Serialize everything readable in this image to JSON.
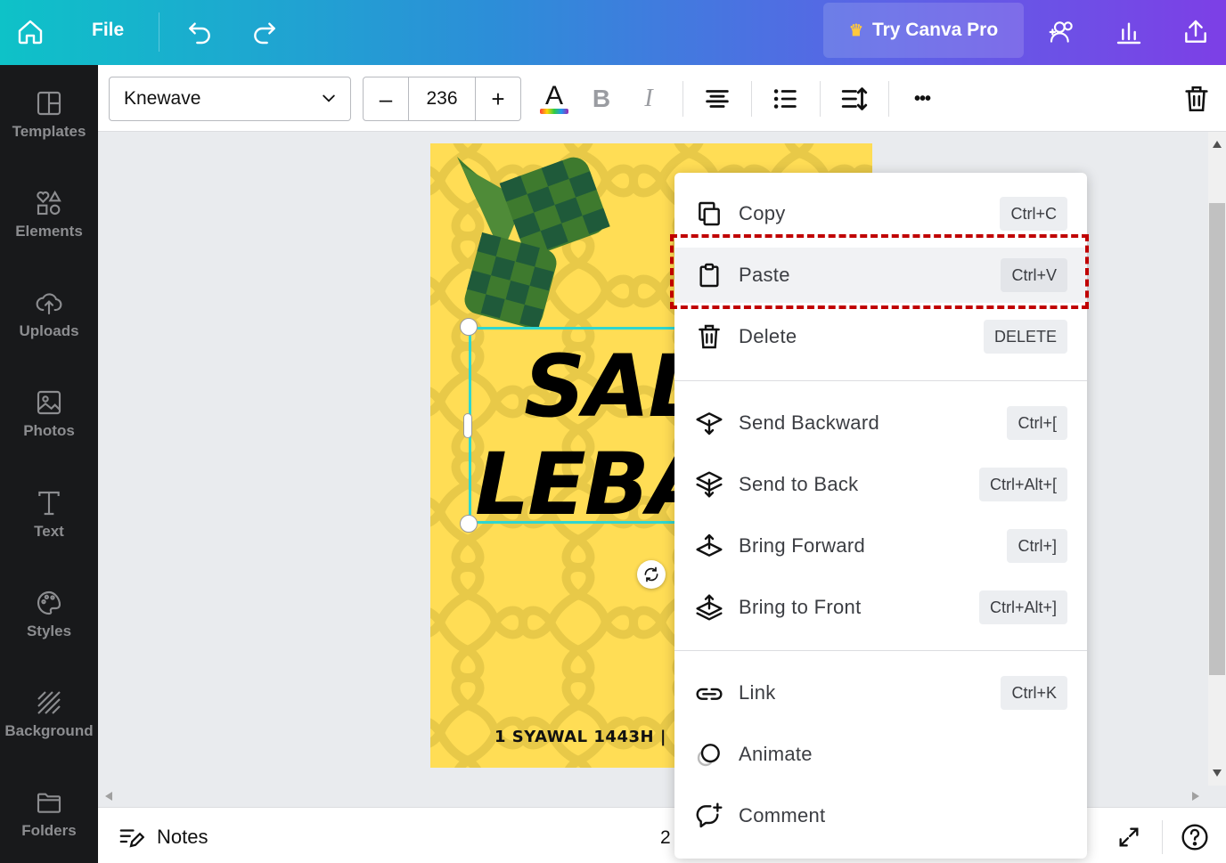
{
  "topbar": {
    "file_label": "File",
    "try_pro_label": "Try Canva Pro",
    "icons": [
      "home-icon",
      "undo-icon",
      "redo-icon",
      "share-people-icon",
      "insights-icon",
      "upload-share-icon"
    ]
  },
  "sidebar": {
    "items": [
      {
        "label": "Templates",
        "icon": "templates-icon"
      },
      {
        "label": "Elements",
        "icon": "elements-icon"
      },
      {
        "label": "Uploads",
        "icon": "uploads-icon"
      },
      {
        "label": "Photos",
        "icon": "photos-icon"
      },
      {
        "label": "Text",
        "icon": "text-icon"
      },
      {
        "label": "Styles",
        "icon": "styles-icon"
      },
      {
        "label": "Background",
        "icon": "background-icon"
      },
      {
        "label": "Folders",
        "icon": "folders-icon"
      }
    ]
  },
  "toolbar": {
    "font_name": "Knewave",
    "font_size": "236",
    "minus_label": "–",
    "plus_label": "+",
    "text_color_letter": "A",
    "bold_letter": "B",
    "italic_letter": "I",
    "more_label": "•••"
  },
  "design": {
    "title_line1": "SALA",
    "title_line2": "LEBAR",
    "footer_text": "1 SYAWAL 1443H  |",
    "background_color": "#ffdd55"
  },
  "context_menu": {
    "items": [
      {
        "label": "Copy",
        "shortcut": "Ctrl+C",
        "icon": "copy-icon"
      },
      {
        "label": "Paste",
        "shortcut": "Ctrl+V",
        "icon": "paste-icon"
      },
      {
        "label": "Delete",
        "shortcut": "DELETE",
        "icon": "trash-icon"
      },
      {
        "label": "Send Backward",
        "shortcut": "Ctrl+[",
        "icon": "send-backward-icon"
      },
      {
        "label": "Send to Back",
        "shortcut": "Ctrl+Alt+[",
        "icon": "send-to-back-icon"
      },
      {
        "label": "Bring Forward",
        "shortcut": "Ctrl+]",
        "icon": "bring-forward-icon"
      },
      {
        "label": "Bring to Front",
        "shortcut": "Ctrl+Alt+]",
        "icon": "bring-to-front-icon"
      },
      {
        "label": "Link",
        "shortcut": "Ctrl+K",
        "icon": "link-icon"
      },
      {
        "label": "Animate",
        "shortcut": "",
        "icon": "animate-icon"
      },
      {
        "label": "Comment",
        "shortcut": "",
        "icon": "comment-icon"
      }
    ],
    "highlight_color": "#c00000"
  },
  "bottombar": {
    "notes_label": "Notes",
    "page_indicator": "2"
  }
}
